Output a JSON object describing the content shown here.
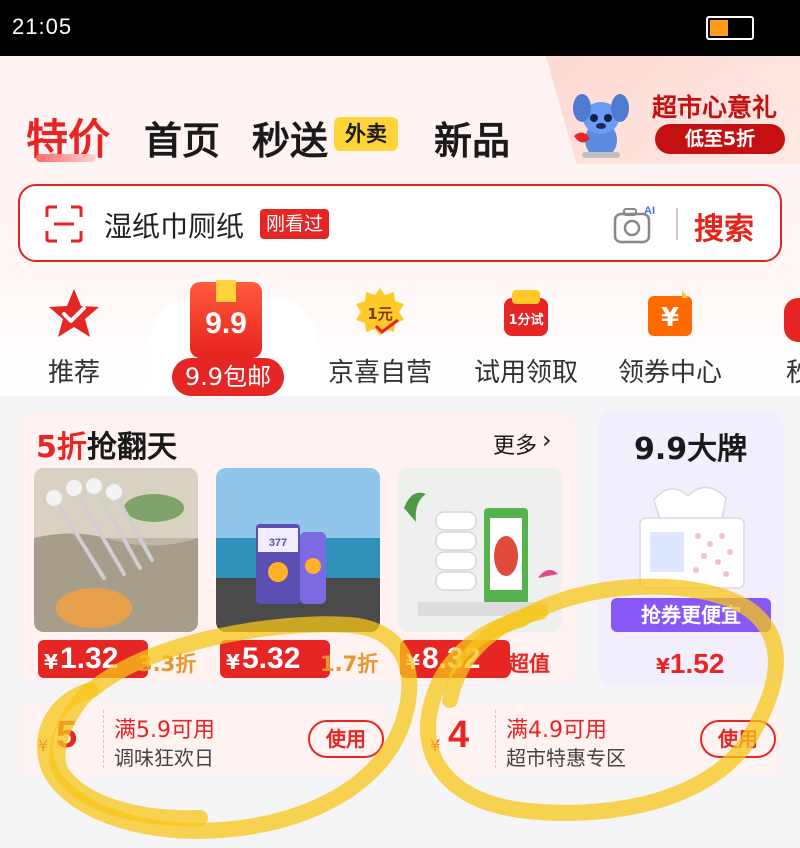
{
  "status_bar": {
    "time": "21:05",
    "battery_level": 0.45,
    "battery_color": "#ff9b1a"
  },
  "tabs": [
    {
      "label": "特价",
      "active": true
    },
    {
      "label": "首页"
    },
    {
      "label": "秒送",
      "badge": "外卖"
    },
    {
      "label": "新品"
    }
  ],
  "promo": {
    "title": "超市心意礼",
    "subtitle": "低至5折"
  },
  "search": {
    "query": "湿纸巾厕纸",
    "tag": "刚看过",
    "camera_badge": "AI",
    "button": "搜索",
    "icons": [
      "scan-icon",
      "camera-icon"
    ]
  },
  "categories": [
    {
      "label": "推荐",
      "icon": "star-check-icon"
    },
    {
      "label": "9.9包邮",
      "icon_text": "9.9",
      "active": true
    },
    {
      "label": "京喜自营",
      "icon_text": "1元"
    },
    {
      "label": "试用领取",
      "icon_text": "1分试"
    },
    {
      "label": "领券中心",
      "icon_text": "¥"
    },
    {
      "label": "秒"
    }
  ],
  "section": {
    "title_highlight": "5折",
    "title_rest": "抢翻天",
    "more": "更多",
    "products": [
      {
        "price_symbol": "¥",
        "price": "1.32",
        "discount": "3.3折",
        "name": "forks"
      },
      {
        "price_symbol": "¥",
        "price": "5.32",
        "discount": "1.7折",
        "name": "sunscreen",
        "product_text": "377"
      },
      {
        "price_symbol": "¥",
        "price": "8.32",
        "discount": "超值",
        "name": "toilet-paper"
      }
    ]
  },
  "side_card": {
    "title": "9.9大牌",
    "button": "抢券更便宜",
    "price_symbol": "¥",
    "price": "1.52"
  },
  "coupons": [
    {
      "symbol": "¥",
      "amount": "5",
      "condition": "满5.9可用",
      "name": "调味狂欢日",
      "button": "使用"
    },
    {
      "symbol": "¥",
      "amount": "4",
      "condition": "满4.9可用",
      "name": "超市特惠专区",
      "button": "使用"
    }
  ],
  "colors": {
    "brand_red": "#e62525",
    "annotation_yellow": "#f5c518",
    "side_purple": "#8758f5"
  }
}
